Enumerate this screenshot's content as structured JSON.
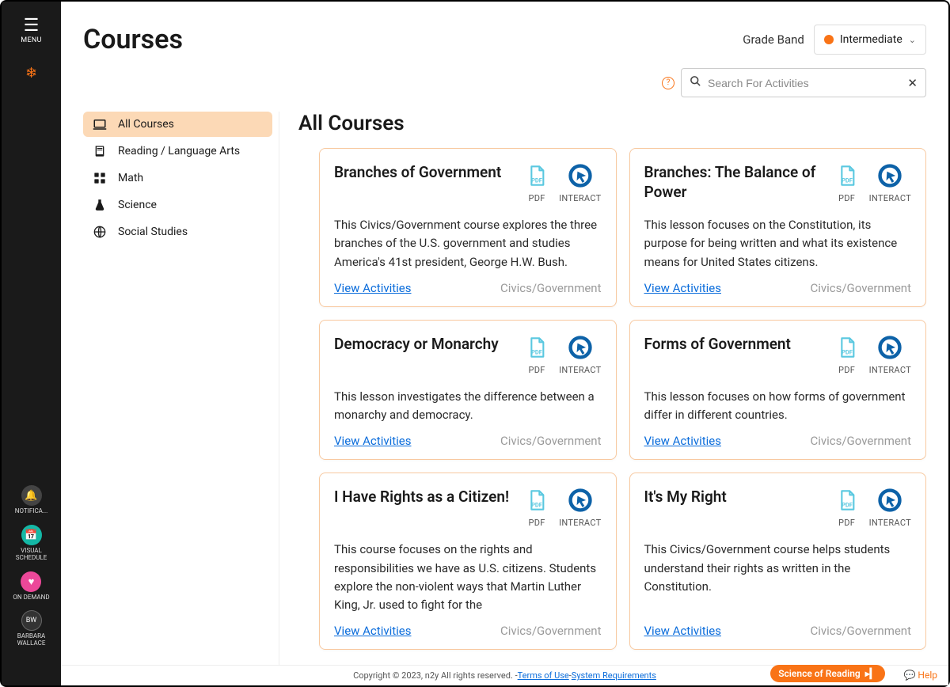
{
  "rail": {
    "menu_label": "MENU",
    "notifications_label": "NOTIFICA...",
    "visual_schedule_label": "VISUAL SCHEDULE",
    "on_demand_label": "ON DEMAND",
    "user_initials": "BW",
    "user_name": "BARBARA WALLACE"
  },
  "header": {
    "title": "Courses",
    "grade_band_label": "Grade Band",
    "grade_selected": "Intermediate"
  },
  "search": {
    "placeholder": "Search For Activities"
  },
  "categories": [
    {
      "key": "all",
      "label": "All Courses",
      "icon": "laptop",
      "active": true
    },
    {
      "key": "reading",
      "label": "Reading / Language Arts",
      "icon": "book",
      "active": false
    },
    {
      "key": "math",
      "label": "Math",
      "icon": "grid",
      "active": false
    },
    {
      "key": "science",
      "label": "Science",
      "icon": "flask",
      "active": false
    },
    {
      "key": "social",
      "label": "Social Studies",
      "icon": "globe",
      "active": false
    }
  ],
  "section_title": "All Courses",
  "action_labels": {
    "pdf": "PDF",
    "interact": "INTERACT"
  },
  "view_activities_label": "View Activities",
  "courses": [
    {
      "title": "Branches of Government",
      "description": "This Civics/Government course explores the three branches of the U.S. government and studies America's 41st president, George H.W. Bush.",
      "tag": "Civics/Government"
    },
    {
      "title": "Branches: The Balance of Power",
      "description": "This lesson focuses on the Constitution, its purpose for being written and what its existence means for United States citizens.",
      "tag": "Civics/Government"
    },
    {
      "title": "Democracy or Monarchy",
      "description": "This lesson investigates the difference between a monarchy and democracy.",
      "tag": "Civics/Government"
    },
    {
      "title": "Forms of Government",
      "description": "This lesson focuses on how forms of government differ in different countries.",
      "tag": "Civics/Government"
    },
    {
      "title": "I Have Rights as a Citizen!",
      "description": "This course focuses on the rights and responsibilities we have as U.S. citizens. Students explore the non-violent ways that Martin Luther King, Jr. used to fight for the",
      "tag": "Civics/Government"
    },
    {
      "title": "It's My Right",
      "description": "This Civics/Government course helps students understand their rights as written in the Constitution.",
      "tag": "Civics/Government"
    }
  ],
  "footer": {
    "copyright": "Copyright © 2023, n2y All rights reserved. - ",
    "terms": "Terms of Use",
    "dash": " - ",
    "sysreq": "System Requirements",
    "pill": "Science of Reading",
    "help": "Help"
  }
}
